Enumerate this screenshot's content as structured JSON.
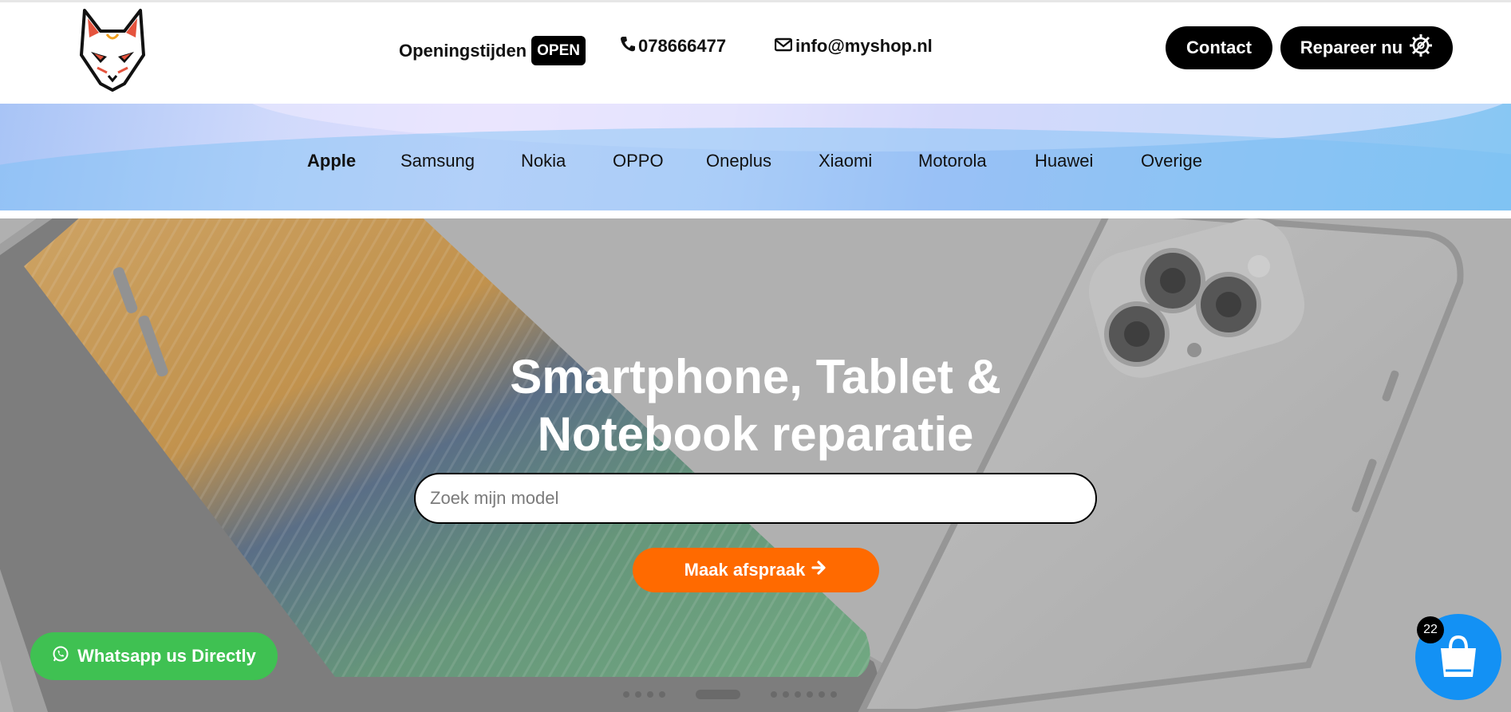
{
  "header": {
    "logo_icon": "fox-mask-logo-icon",
    "hours_label": "Openingstijden",
    "open_badge": "OPEN",
    "phone": "078666477",
    "phone_icon": "phone-icon",
    "email": "info@myshop.nl",
    "email_icon": "envelope-icon",
    "contact_label": "Contact",
    "repair_label": "Repareer nu",
    "repair_icon": "gear-wrench-icon"
  },
  "nav": {
    "items": [
      {
        "label": "Apple",
        "active": true
      },
      {
        "label": "Samsung"
      },
      {
        "label": "Nokia"
      },
      {
        "label": "OPPO"
      },
      {
        "label": "Oneplus"
      },
      {
        "label": "Xiaomi"
      },
      {
        "label": "Motorola"
      },
      {
        "label": "Huawei"
      },
      {
        "label": "Overige"
      }
    ]
  },
  "hero": {
    "title_line1": "Smartphone, Tablet &",
    "title_line2": "Notebook reparatie",
    "search_placeholder": "Zoek mijn model",
    "cta_label": "Maak afspraak",
    "cta_icon": "arrow-right-icon"
  },
  "whatsapp": {
    "label": "Whatsapp us Directly",
    "icon": "whatsapp-icon",
    "color": "#3fc152"
  },
  "cart": {
    "count": "22",
    "icon": "shopping-bag-icon",
    "color": "#1391f4"
  },
  "colors": {
    "cta": "#ff6a00",
    "button_dark": "#000000"
  }
}
